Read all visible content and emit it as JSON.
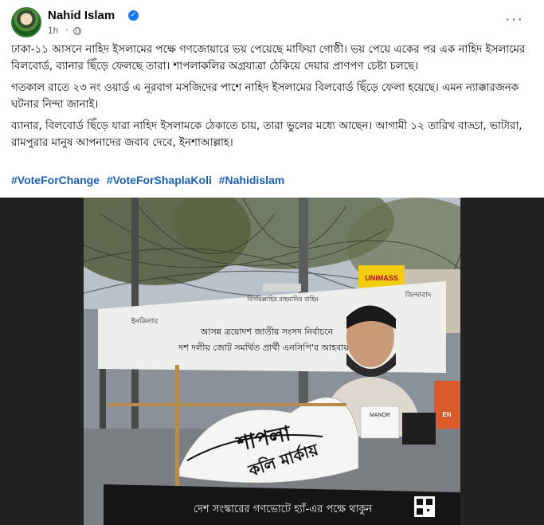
{
  "post": {
    "author": "Nahid Islam",
    "time": "1h",
    "paragraphs": [
      "ঢাকা-১১ আসনে নাহিদ ইসলামের পক্ষে গণজোয়ারে ভয় পেয়েছে মাফিয়া গোষ্ঠী। ভয় পেয়ে একের পর এক নাহিদ ইসলামের বিলবোর্ড, ব্যানার ছিঁড়ে ফেলছে তারা। শাপলাকলির অগ্রযাত্রা ঠেকিয়ে দেয়ার প্রাণপণ চেষ্টা চলছে।",
      "গতকাল রাতে ২৩ নং ওয়ার্ড এ নূরবাগ মসজিদের পাশে নাহিদ ইসলামের বিলবোর্ড ছিঁড়ে ফেলা হয়েছে। এমন ন্যাক্কারজনক ঘটনার নিন্দা জানাই।",
      "ব্যানার, বিলবোর্ড ছিঁড়ে যারা নাহিদ ইসলামকে ঠেকাতে চায়, তারা ভুলের মধ্যে আছেন। আগামী ১২ তারিখ বাড্ডা, ভাটারা, রামপুরার মানুষ আপনাদের জবাব দেবে, ইনশাআল্লাহ।"
    ],
    "hashtags": [
      "#VoteForChange",
      "#VoteForShaplaKoli",
      "#Nahidislam"
    ]
  },
  "photo": {
    "banner_bismillah": "বিসমিল্লাহির রাহমানির রাহিম",
    "banner_left": "ইনকিলাব",
    "banner_right": "জিন্দাবাদ",
    "banner_line1": "আসন্ন ত্রয়োদশ জাতীয় সংসদ নির্বাচনে",
    "banner_line2": "দশ দলীয় জোট সমর্থিত প্রার্থী এনসিপি'র আহবায়ক",
    "bottom_strip": "দেশ সংস্কারের গণভোটে হ্যাঁ-এর পক্ষে থাকুন",
    "torn_text_1": "শাপলা",
    "torn_text_2": "কলি মার্কায়",
    "sign_unimass": "UNIMASS",
    "sign_manor": "MANOR",
    "sign_en": "EN"
  },
  "icons": {
    "verified": "verified-badge-icon",
    "globe": "globe-icon",
    "more": "more-options-icon"
  },
  "colors": {
    "hashtag": "#1a5fb4",
    "verified": "#1877f2"
  }
}
